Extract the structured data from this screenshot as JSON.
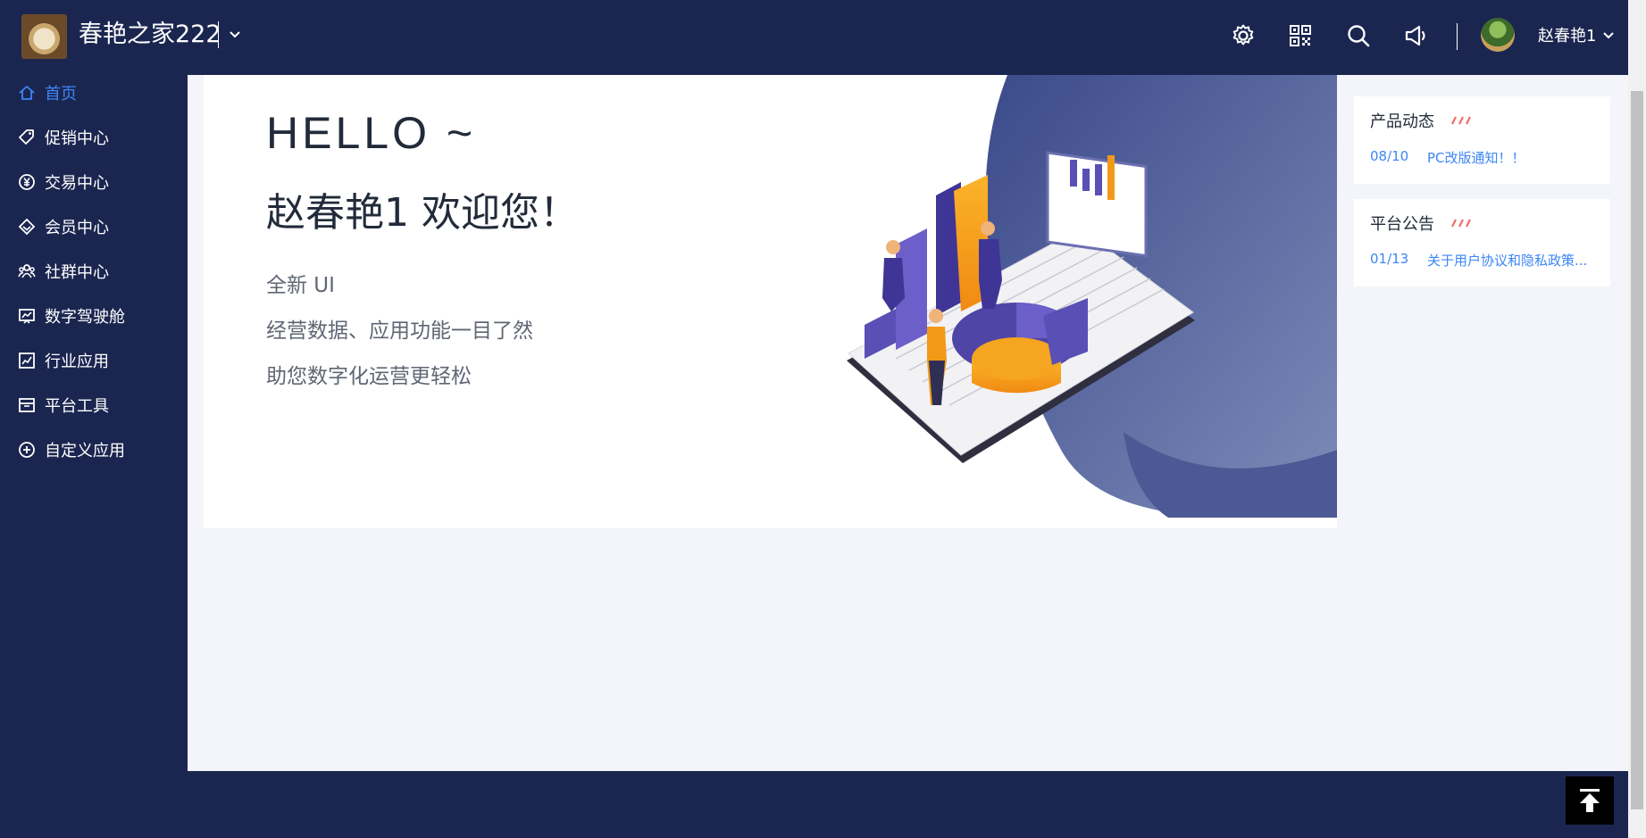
{
  "header": {
    "app_title": "春艳之家222",
    "user_name": "赵春艳1",
    "icons": [
      "gear-icon",
      "qrcode-icon",
      "search-icon",
      "megaphone-icon"
    ]
  },
  "sidebar": {
    "items": [
      {
        "label": "首页",
        "icon": "home-icon",
        "active": true
      },
      {
        "label": "促销中心",
        "icon": "tag-icon",
        "active": false
      },
      {
        "label": "交易中心",
        "icon": "yen-coin-icon",
        "active": false
      },
      {
        "label": "会员中心",
        "icon": "diamond-icon",
        "active": false
      },
      {
        "label": "社群中心",
        "icon": "group-icon",
        "active": false
      },
      {
        "label": "数字驾驶舱",
        "icon": "dashboard-chart-icon",
        "active": false
      },
      {
        "label": "行业应用",
        "icon": "line-chart-icon",
        "active": false
      },
      {
        "label": "平台工具",
        "icon": "toolbox-icon",
        "active": false
      },
      {
        "label": "自定义应用",
        "icon": "plus-circle-icon",
        "active": false
      }
    ]
  },
  "banner": {
    "hello": "HELLO ~",
    "welcome": "赵春艳1 欢迎您！",
    "lines": [
      "全新 UI",
      "经营数据、应用功能一目了然",
      "助您数字化运营更轻松"
    ]
  },
  "cards": [
    {
      "title": "产品动态",
      "items": [
        {
          "date": "08/10",
          "text": "PC改版通知！！"
        }
      ]
    },
    {
      "title": "平台公告",
      "items": [
        {
          "date": "01/13",
          "text": "关于用户协议和隐私政策..."
        }
      ]
    }
  ],
  "colors": {
    "nav_bg": "#1b2650",
    "accent": "#3d86f5",
    "content_bg": "#f4f5fa",
    "slash_accent": "#f26a6a"
  }
}
